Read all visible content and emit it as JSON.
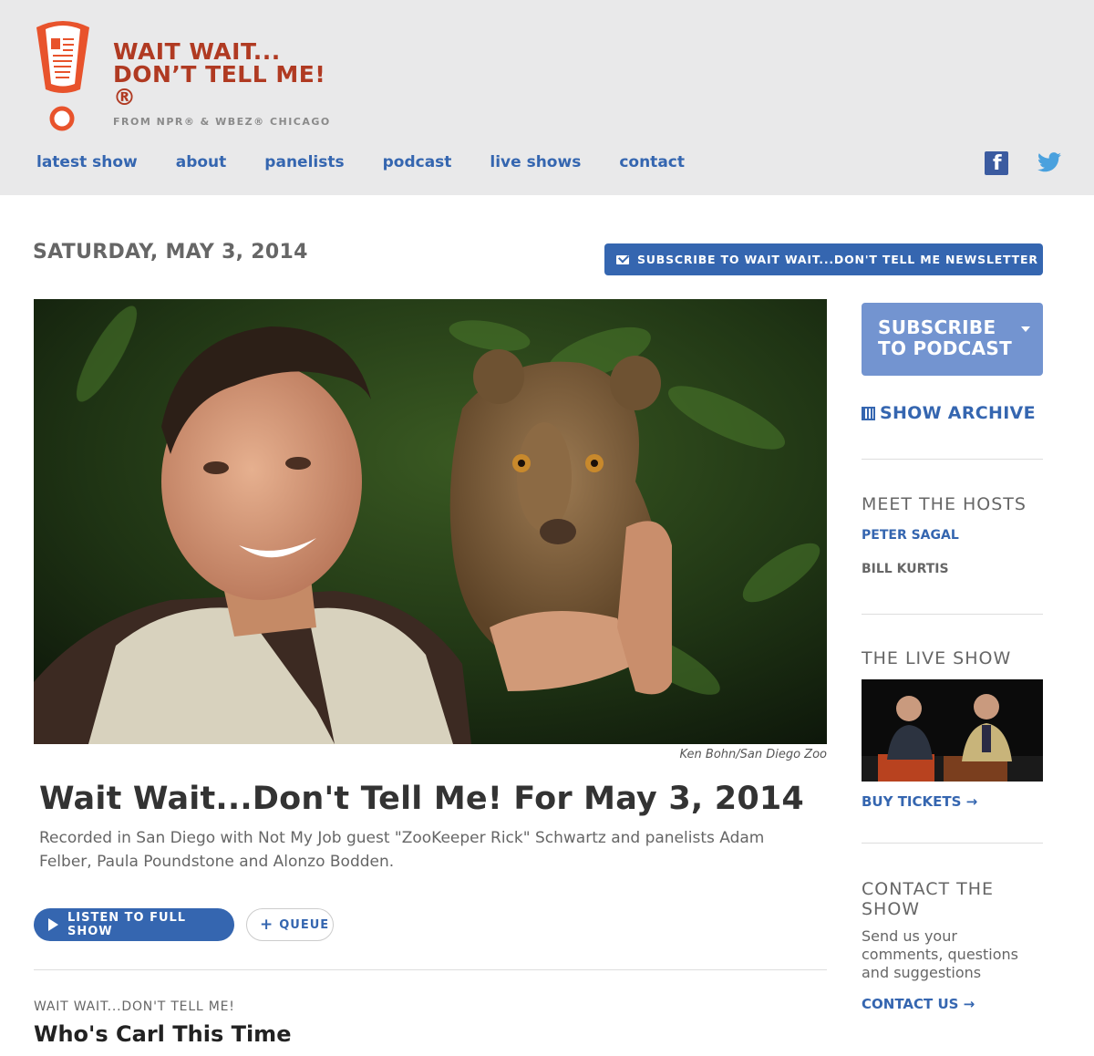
{
  "logo": {
    "line1": "WAIT WAIT...",
    "line2": "DON’T TELL ME!®",
    "line3": "FROM NPR® & WBEZ® CHICAGO"
  },
  "nav": {
    "items": [
      {
        "label": "latest show"
      },
      {
        "label": "about"
      },
      {
        "label": "panelists"
      },
      {
        "label": "podcast"
      },
      {
        "label": "live shows"
      },
      {
        "label": "contact"
      }
    ]
  },
  "social": {
    "facebook_icon": "facebook-icon",
    "twitter_icon": "twitter-icon"
  },
  "main": {
    "date": "SATURDAY, MAY 3, 2014",
    "newsletter_label": "SUBSCRIBE TO WAIT WAIT...DON'T TELL ME NEWSLETTER",
    "photo_caption": "Ken Bohn/San Diego Zoo",
    "show_title": "Wait Wait...Don't Tell Me! For May 3, 2014",
    "show_description": "Recorded in San Diego with Not My Job guest \"ZooKeeper Rick\" Schwartz and panelists Adam Felber, Paula Poundstone and Alonzo Bodden.",
    "listen_label": "LISTEN TO FULL SHOW",
    "queue_label": "QUEUE",
    "story_kicker": "WAIT WAIT...DON'T TELL ME!",
    "story_title": "Who's Carl This Time"
  },
  "sidebar": {
    "subscribe_podcast": "SUBSCRIBE TO PODCAST",
    "show_archive": "SHOW ARCHIVE",
    "meet_hosts_heading": "MEET THE HOSTS",
    "hosts": [
      "PETER SAGAL",
      "BILL KURTIS"
    ],
    "live_show_heading": "THE LIVE SHOW",
    "buy_tickets": "BUY TICKETS →",
    "contact_heading": "CONTACT THE SHOW",
    "contact_text": "Send us your comments, questions and suggestions",
    "contact_us": "CONTACT US →"
  },
  "colors": {
    "brand_red": "#b03a22",
    "link_blue": "#3566b0",
    "header_bg": "#e9e9ea"
  }
}
